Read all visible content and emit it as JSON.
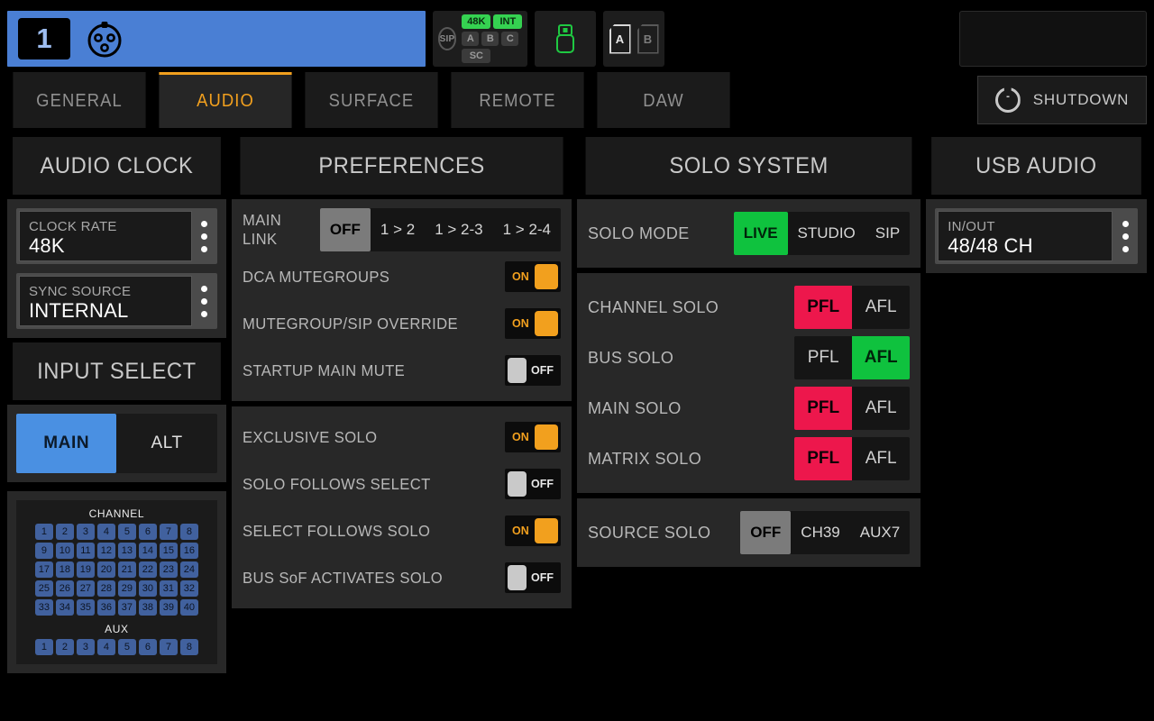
{
  "topbar": {
    "scene_number": "1",
    "scene_icon": "xlr-connector-icon",
    "clock_status": {
      "sip_label": "SIP",
      "rate_label": "48K",
      "sync_label": "INT",
      "slots": [
        "A",
        "B",
        "C"
      ],
      "sc_label": "SC"
    },
    "usb_icon": "usb-drive-icon",
    "card_a": "A",
    "card_b": "B"
  },
  "tabs": [
    {
      "label": "GENERAL",
      "active": false
    },
    {
      "label": "AUDIO",
      "active": true
    },
    {
      "label": "SURFACE",
      "active": false
    },
    {
      "label": "REMOTE",
      "active": false
    },
    {
      "label": "DAW",
      "active": false
    }
  ],
  "shutdown": {
    "label": "SHUTDOWN",
    "icon": "power-icon"
  },
  "audio_clock": {
    "title": "AUDIO CLOCK",
    "clock_rate": {
      "label": "CLOCK RATE",
      "value": "48K"
    },
    "sync_source": {
      "label": "SYNC SOURCE",
      "value": "INTERNAL"
    }
  },
  "input_select": {
    "title": "INPUT SELECT",
    "options": [
      {
        "label": "MAIN",
        "selected": true
      },
      {
        "label": "ALT",
        "selected": false
      }
    ],
    "channel_title": "CHANNEL",
    "channel_rows": [
      [
        "1",
        "2",
        "3",
        "4",
        "5",
        "6",
        "7",
        "8"
      ],
      [
        "9",
        "10",
        "11",
        "12",
        "13",
        "14",
        "15",
        "16"
      ],
      [
        "17",
        "18",
        "19",
        "20",
        "21",
        "22",
        "23",
        "24"
      ],
      [
        "25",
        "26",
        "27",
        "28",
        "29",
        "30",
        "31",
        "32"
      ],
      [
        "33",
        "34",
        "35",
        "36",
        "37",
        "38",
        "39",
        "40"
      ]
    ],
    "aux_title": "AUX",
    "aux_row": [
      "1",
      "2",
      "3",
      "4",
      "5",
      "6",
      "7",
      "8"
    ]
  },
  "preferences": {
    "title": "PREFERENCES",
    "main_link": {
      "label": "MAIN LINK",
      "options": [
        "OFF",
        "1 > 2",
        "1 > 2-3",
        "1 > 2-4"
      ],
      "selected": "OFF"
    },
    "group1": [
      {
        "label": "DCA MUTEGROUPS",
        "state": "ON"
      },
      {
        "label": "MUTEGROUP/SIP OVERRIDE",
        "state": "ON"
      },
      {
        "label": "STARTUP MAIN MUTE",
        "state": "OFF"
      }
    ],
    "group2": [
      {
        "label": "EXCLUSIVE SOLO",
        "state": "ON"
      },
      {
        "label": "SOLO FOLLOWS SELECT",
        "state": "OFF"
      },
      {
        "label": "SELECT FOLLOWS SOLO",
        "state": "ON"
      },
      {
        "label": "BUS SoF ACTIVATES SOLO",
        "state": "OFF"
      }
    ]
  },
  "solo_system": {
    "title": "SOLO SYSTEM",
    "solo_mode": {
      "label": "SOLO MODE",
      "options": [
        "LIVE",
        "STUDIO",
        "SIP"
      ],
      "selected": "LIVE"
    },
    "pfl_afl_rows": [
      {
        "label": "CHANNEL SOLO",
        "pfl": "PFL",
        "afl": "AFL",
        "selected": "PFL"
      },
      {
        "label": "BUS SOLO",
        "pfl": "PFL",
        "afl": "AFL",
        "selected": "AFL"
      },
      {
        "label": "MAIN SOLO",
        "pfl": "PFL",
        "afl": "AFL",
        "selected": "PFL"
      },
      {
        "label": "MATRIX SOLO",
        "pfl": "PFL",
        "afl": "AFL",
        "selected": "PFL"
      }
    ],
    "source_solo": {
      "label": "SOURCE SOLO",
      "options": [
        "OFF",
        "CH39",
        "AUX7"
      ],
      "selected": "OFF"
    }
  },
  "usb_audio": {
    "title": "USB AUDIO",
    "in_out": {
      "label": "IN/OUT",
      "value": "48/48 CH"
    }
  },
  "colors": {
    "accent_orange": "#f2a01e",
    "scene_blue": "#4a7fd4",
    "select_blue": "#4a90e2",
    "green": "#0fc23e",
    "red": "#ed174c",
    "channel_blue": "#41619e"
  }
}
